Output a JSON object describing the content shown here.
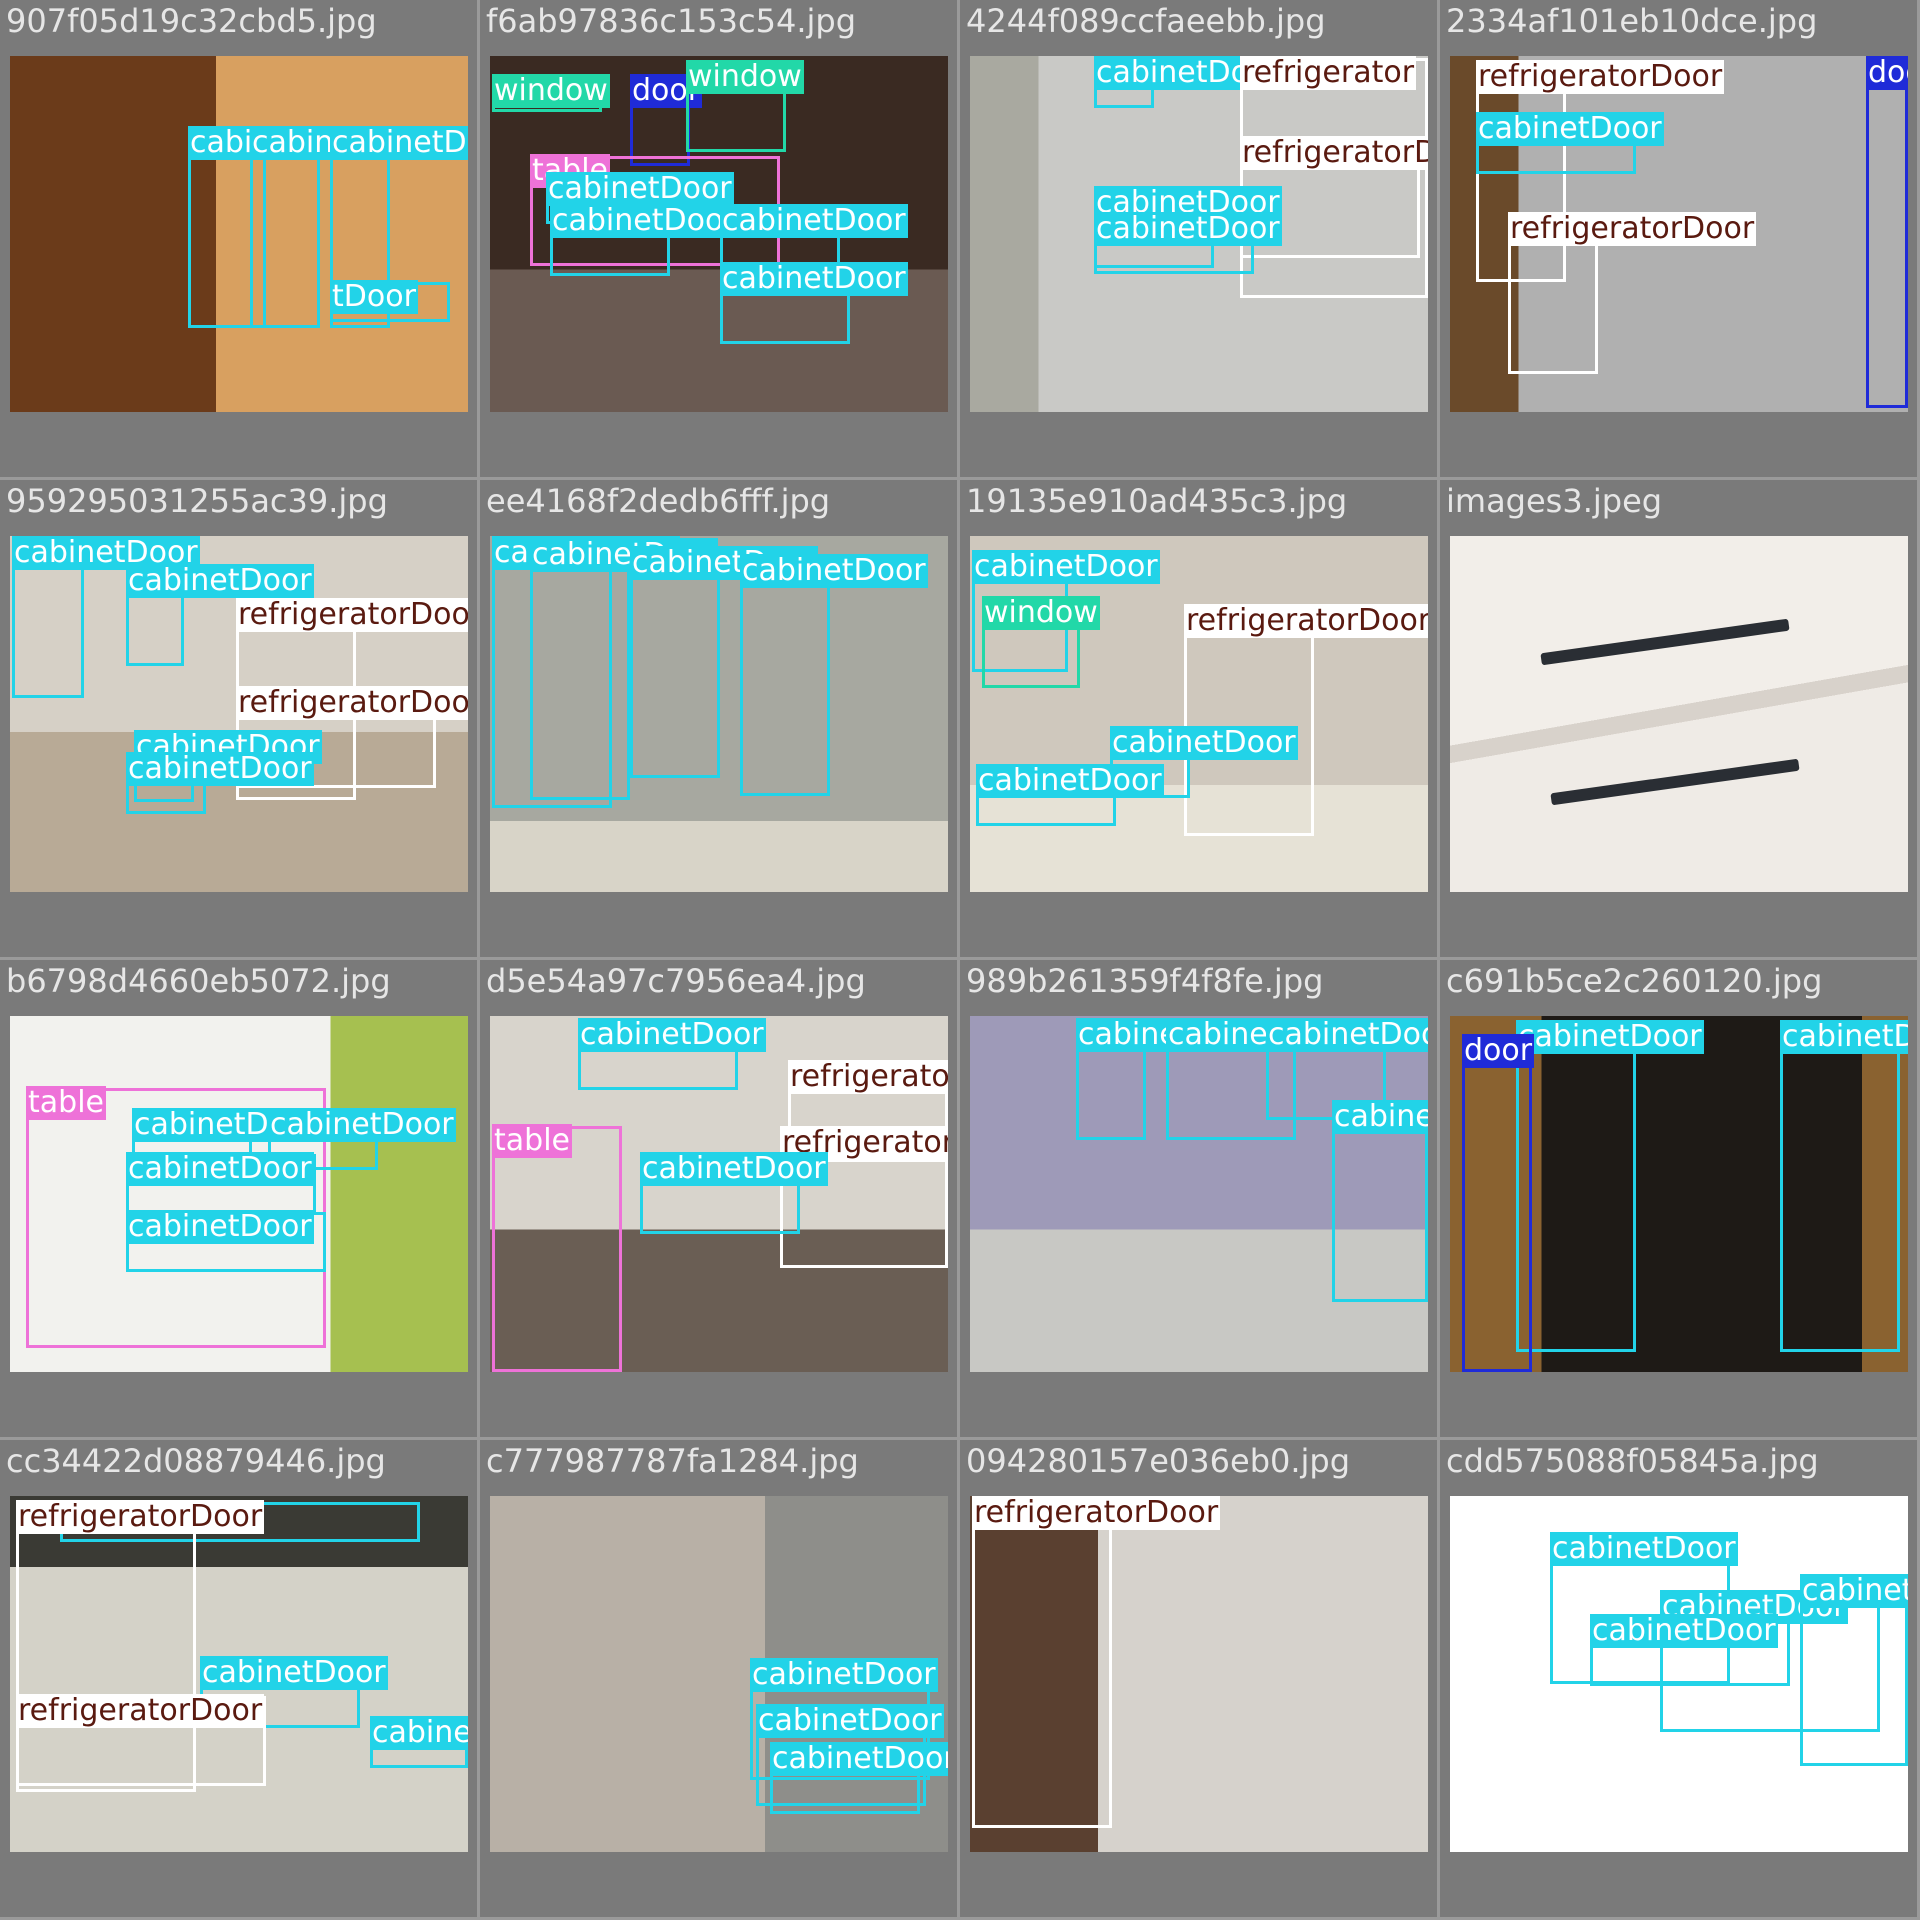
{
  "colors": {
    "cabinetDoor": "#22d3e8",
    "refrigeratorDoor": "#ffffff",
    "window": "#22d8a8",
    "door": "#1f2bd8",
    "table": "#ee72d8",
    "drawer": "#ee4444"
  },
  "tiles": [
    {
      "filename": "907f05d19c32cbd5.jpg",
      "scene": "wood",
      "labels": [
        {
          "text": "cabinetDoor",
          "cls": "cabinetDoor"
        },
        {
          "text": "cabinetDoor",
          "cls": "cabinetDoor"
        },
        {
          "text": "cabinetDoor",
          "cls": "cabinetDoor"
        },
        {
          "text": "tDoor",
          "cls": "cabinetDoor"
        }
      ]
    },
    {
      "filename": "f6ab97836c153c54.jpg",
      "scene": "dark-kitchen",
      "labels": [
        {
          "text": "window",
          "cls": "window"
        },
        {
          "text": "door",
          "cls": "door"
        },
        {
          "text": "window",
          "cls": "window"
        },
        {
          "text": "table",
          "cls": "table"
        },
        {
          "text": "cabinetDoor",
          "cls": "cabinetDoor"
        },
        {
          "text": "cabinetDoor",
          "cls": "cabinetDoor"
        },
        {
          "text": "cabinetDoor",
          "cls": "cabinetDoor"
        },
        {
          "text": "cabinetDoor",
          "cls": "cabinetDoor"
        }
      ]
    },
    {
      "filename": "4244f089ccfaeebb.jpg",
      "scene": "grey-kitchen",
      "labels": [
        {
          "text": "cabinetDoor",
          "cls": "cabinetDoor"
        },
        {
          "text": "refrigerator",
          "cls": "refrigeratorDoor"
        },
        {
          "text": "refrigeratorDoor",
          "cls": "refrigeratorDoor"
        },
        {
          "text": "cabinetDoor",
          "cls": "cabinetDoor"
        },
        {
          "text": "cabinetDoor",
          "cls": "cabinetDoor"
        }
      ]
    },
    {
      "filename": "2334af101eb10dce.jpg",
      "scene": "laundry",
      "labels": [
        {
          "text": "refrigeratorDoor",
          "cls": "refrigeratorDoor"
        },
        {
          "text": "door",
          "cls": "door"
        },
        {
          "text": "cabinetDoor",
          "cls": "cabinetDoor"
        },
        {
          "text": "refrigeratorDoor",
          "cls": "refrigeratorDoor"
        }
      ]
    },
    {
      "filename": "959295031255ac39.jpg",
      "scene": "small-kitchen",
      "labels": [
        {
          "text": "cabinetDoor",
          "cls": "cabinetDoor"
        },
        {
          "text": "cabinetDoor",
          "cls": "cabinetDoor"
        },
        {
          "text": "refrigeratorDoor",
          "cls": "refrigeratorDoor"
        },
        {
          "text": "refrigeratorDoor",
          "cls": "refrigeratorDoor"
        },
        {
          "text": "cabinetDoor",
          "cls": "cabinetDoor"
        },
        {
          "text": "cabinetDoor",
          "cls": "cabinetDoor"
        }
      ]
    },
    {
      "filename": "ee4168f2dedb6fff.jpg",
      "scene": "lockers",
      "labels": [
        {
          "text": "cabinetDoor",
          "cls": "cabinetDoor"
        },
        {
          "text": "cabinetDoor",
          "cls": "cabinetDoor"
        },
        {
          "text": "cabinetDoor",
          "cls": "cabinetDoor"
        },
        {
          "text": "cabinetDoor",
          "cls": "cabinetDoor"
        }
      ]
    },
    {
      "filename": "19135e910ad435c3.jpg",
      "scene": "empty-kitchen",
      "labels": [
        {
          "text": "cabinetDoor",
          "cls": "cabinetDoor"
        },
        {
          "text": "window",
          "cls": "window"
        },
        {
          "text": "refrigeratorDoor",
          "cls": "refrigeratorDoor"
        },
        {
          "text": "cabinetDoor",
          "cls": "cabinetDoor"
        },
        {
          "text": "cabinetDoor",
          "cls": "cabinetDoor"
        }
      ]
    },
    {
      "filename": "images3.jpeg",
      "scene": "handles",
      "labels": []
    },
    {
      "filename": "b6798d4660eb5072.jpg",
      "scene": "bedroom",
      "labels": [
        {
          "text": "table",
          "cls": "table"
        },
        {
          "text": "cabinetDoor",
          "cls": "cabinetDoor"
        },
        {
          "text": "cabinetDoor",
          "cls": "cabinetDoor"
        },
        {
          "text": "cabinetDoor",
          "cls": "cabinetDoor"
        },
        {
          "text": "cabinetDoor",
          "cls": "cabinetDoor"
        }
      ]
    },
    {
      "filename": "d5e54a97c7956ea4.jpg",
      "scene": "stove-kitchen",
      "labels": [
        {
          "text": "cabinetDoor",
          "cls": "cabinetDoor"
        },
        {
          "text": "refrigeratorDoor",
          "cls": "refrigeratorDoor"
        },
        {
          "text": "table",
          "cls": "table"
        },
        {
          "text": "refrigeratorDoor",
          "cls": "refrigeratorDoor"
        },
        {
          "text": "cabinetDoor",
          "cls": "cabinetDoor"
        }
      ]
    },
    {
      "filename": "989b261359f4f8fe.jpg",
      "scene": "purple-kitchen",
      "labels": [
        {
          "text": "cabinetDoor",
          "cls": "cabinetDoor"
        },
        {
          "text": "cabinetDoor",
          "cls": "cabinetDoor"
        },
        {
          "text": "cabinetDoor",
          "cls": "cabinetDoor"
        },
        {
          "text": "cabinetDoor",
          "cls": "cabinetDoor"
        }
      ]
    },
    {
      "filename": "c691b5ce2c260120.jpg",
      "scene": "closet",
      "labels": [
        {
          "text": "cabinetDoor",
          "cls": "cabinetDoor"
        },
        {
          "text": "cabinetDoor",
          "cls": "cabinetDoor"
        },
        {
          "text": "door",
          "cls": "door"
        }
      ]
    },
    {
      "filename": "cc34422d08879446.jpg",
      "scene": "retro-fridge",
      "labels": [
        {
          "text": "cabinetDoor",
          "cls": "cabinetDoor"
        },
        {
          "text": "refrigeratorDoor",
          "cls": "refrigeratorDoor"
        },
        {
          "text": "cabinetDoor",
          "cls": "cabinetDoor"
        },
        {
          "text": "refrigeratorDoor",
          "cls": "refrigeratorDoor"
        },
        {
          "text": "cabinetDoor",
          "cls": "cabinetDoor"
        }
      ]
    },
    {
      "filename": "c777987787fa1284.jpg",
      "scene": "bathroom",
      "labels": [
        {
          "text": "cabinetDoor",
          "cls": "cabinetDoor"
        },
        {
          "text": "cabinetDoor",
          "cls": "cabinetDoor"
        },
        {
          "text": "cabinetDoor",
          "cls": "cabinetDoor"
        }
      ]
    },
    {
      "filename": "094280157e036eb0.jpg",
      "scene": "open-fridge",
      "labels": [
        {
          "text": "refrigeratorDoor",
          "cls": "refrigeratorDoor"
        }
      ]
    },
    {
      "filename": "cdd575088f05845a.jpg",
      "scene": "white-drawers",
      "labels": [
        {
          "text": "cabinetDoor",
          "cls": "cabinetDoor"
        },
        {
          "text": "cabinetDoor",
          "cls": "cabinetDoor"
        },
        {
          "text": "cabinetDoor",
          "cls": "cabinetDoor"
        },
        {
          "text": "cabinetDoor",
          "cls": "cabinetDoor"
        }
      ]
    }
  ]
}
